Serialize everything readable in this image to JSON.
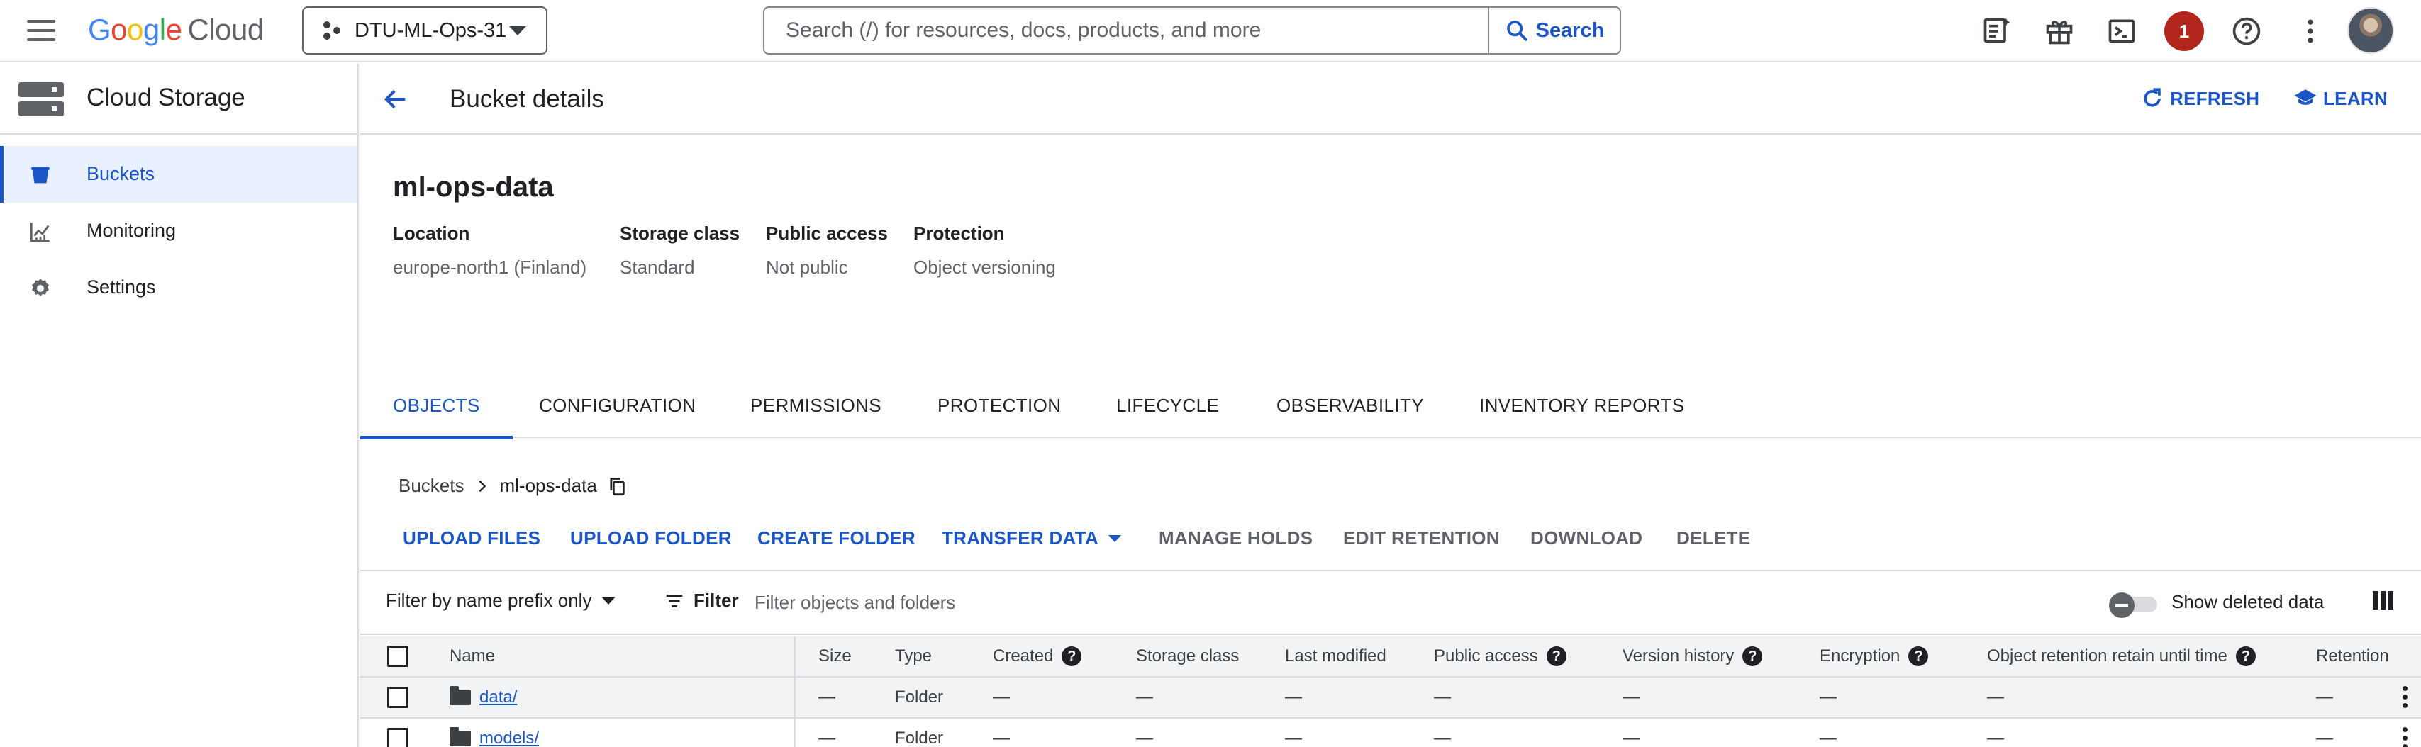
{
  "topbar": {
    "logo_google": [
      "G",
      "o",
      "o",
      "g",
      "l",
      "e"
    ],
    "logo_cloud": "Cloud",
    "project": "DTU-ML-Ops-31",
    "search_placeholder": "Search (/) for resources, docs, products, and more",
    "search_button": "Search",
    "notification_count": "1"
  },
  "sidebar": {
    "title": "Cloud Storage",
    "items": [
      {
        "label": "Buckets",
        "icon": "bucket-icon",
        "active": true
      },
      {
        "label": "Monitoring",
        "icon": "monitoring-icon",
        "active": false
      },
      {
        "label": "Settings",
        "icon": "gear-icon",
        "active": false
      }
    ]
  },
  "header": {
    "title": "Bucket details",
    "refresh": "REFRESH",
    "learn": "LEARN"
  },
  "bucket": {
    "name": "ml-ops-data",
    "meta": [
      {
        "label": "Location",
        "value": "europe-north1 (Finland)"
      },
      {
        "label": "Storage class",
        "value": "Standard"
      },
      {
        "label": "Public access",
        "value": "Not public"
      },
      {
        "label": "Protection",
        "value": "Object versioning"
      }
    ]
  },
  "tabs": [
    "OBJECTS",
    "CONFIGURATION",
    "PERMISSIONS",
    "PROTECTION",
    "LIFECYCLE",
    "OBSERVABILITY",
    "INVENTORY REPORTS"
  ],
  "active_tab": "OBJECTS",
  "breadcrumb": {
    "root": "Buckets",
    "current": "ml-ops-data"
  },
  "actions": {
    "upload_files": "UPLOAD FILES",
    "upload_folder": "UPLOAD FOLDER",
    "create_folder": "CREATE FOLDER",
    "transfer_data": "TRANSFER DATA",
    "manage_holds": "MANAGE HOLDS",
    "edit_retention": "EDIT RETENTION",
    "download": "DOWNLOAD",
    "delete": "DELETE"
  },
  "filter": {
    "prefix_select": "Filter by name prefix only",
    "filter_label": "Filter",
    "placeholder": "Filter objects and folders",
    "show_deleted": "Show deleted data"
  },
  "table": {
    "headers": [
      "Name",
      "Size",
      "Type",
      "Created",
      "Storage class",
      "Last modified",
      "Public access",
      "Version history",
      "Encryption",
      "Object retention retain until time",
      "Retention"
    ],
    "rows": [
      {
        "name": "data/",
        "size": "—",
        "type": "Folder",
        "created": "—",
        "storage_class": "—",
        "last_modified": "—",
        "public_access": "—",
        "version_history": "—",
        "encryption": "—",
        "retain_until": "—",
        "retention": "—"
      },
      {
        "name": "models/",
        "size": "—",
        "type": "Folder",
        "created": "—",
        "storage_class": "—",
        "last_modified": "—",
        "public_access": "—",
        "version_history": "—",
        "encryption": "—",
        "retain_until": "—",
        "retention": "—"
      }
    ]
  },
  "colors": {
    "accent": "#1a56c8",
    "badge": "#b3261e",
    "active_bg": "#e8f0fe"
  }
}
